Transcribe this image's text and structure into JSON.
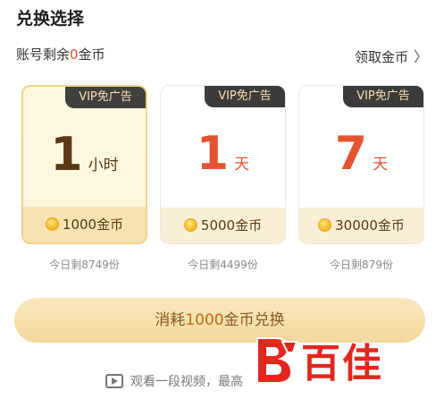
{
  "header": {
    "title": "兑换选择"
  },
  "balance": {
    "prefix": "账号剩余",
    "coins": "0",
    "suffix": "金币",
    "claim_label": "领取金币",
    "claim_chevron": "〉"
  },
  "cards": [
    {
      "tag": "VIP免广告",
      "number": "1",
      "unit": "小时",
      "price": "1000金币",
      "stock": "今日剩8749份",
      "selected": true
    },
    {
      "tag": "VIP免广告",
      "number": "1",
      "unit": "天",
      "price": "5000金币",
      "stock": "今日剩4499份",
      "selected": false
    },
    {
      "tag": "VIP免广告",
      "number": "7",
      "unit": "天",
      "price": "30000金币",
      "stock": "今日剩879份",
      "selected": false
    }
  ],
  "exchange": {
    "prefix": "消耗",
    "amount": "1000",
    "suffix": "金币兑换"
  },
  "video": {
    "label": "观看一段视频，最高"
  },
  "watermark": {
    "text": "百佳"
  },
  "colors": {
    "accent_red": "#e45430",
    "gold_bg": "#f3d89c",
    "tag_bg": "#404040",
    "watermark_red": "#e2271d"
  },
  "icons": {
    "coin": "coin-icon",
    "chevron": "chevron-right-icon",
    "video": "video-icon"
  }
}
